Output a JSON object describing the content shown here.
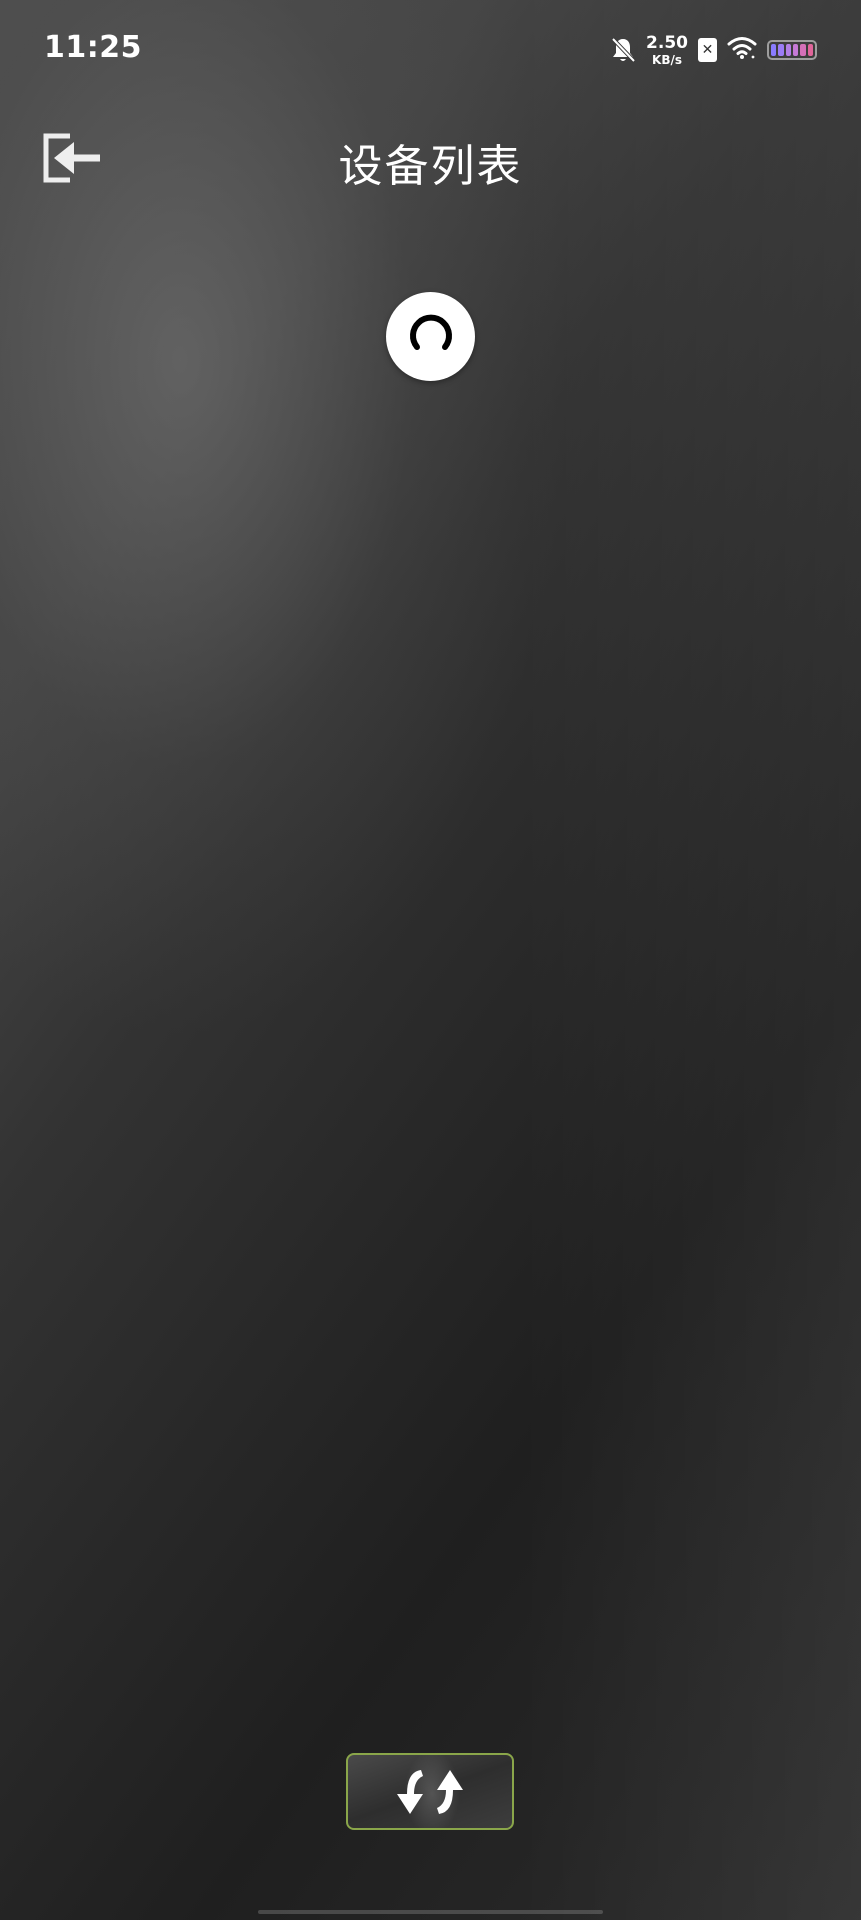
{
  "status_bar": {
    "time": "11:25",
    "net_speed_value": "2.50",
    "net_speed_unit": "KB/s",
    "sim_label": "✕",
    "icons": [
      "bell-muted-icon",
      "sim-icon",
      "wifi-icon",
      "battery-icon"
    ],
    "battery_colors": [
      "#8a7cff",
      "#9b7cf5",
      "#b27fe6",
      "#c67ad6",
      "#d570b8",
      "#e0659a"
    ]
  },
  "header": {
    "title": "设备列表",
    "back_icon": "exit-arrow-icon"
  },
  "loading": {
    "icon": "loading-spinner-icon"
  },
  "bottom": {
    "switch_icon": "swap-arrows-icon",
    "border_color": "#8aa64a"
  }
}
